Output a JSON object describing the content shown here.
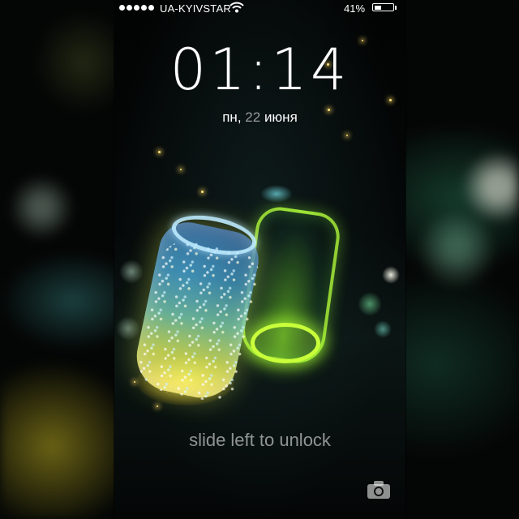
{
  "status_bar": {
    "carrier": "UA-KYIVSTAR",
    "battery_percent": "41%",
    "battery_level": 0.41,
    "signal_dots": 5
  },
  "lock_screen": {
    "time": "01:14",
    "date_weekday": "пн,",
    "date_day": "22",
    "date_month": "июня",
    "unlock_hint": "slide left to unlock"
  },
  "icons": {
    "wifi": "wifi-icon",
    "battery": "battery-icon",
    "camera": "camera-icon"
  },
  "colors": {
    "text": "#ffffff",
    "hint": "#ffffff8c",
    "date_day": "#9a9a9a"
  }
}
